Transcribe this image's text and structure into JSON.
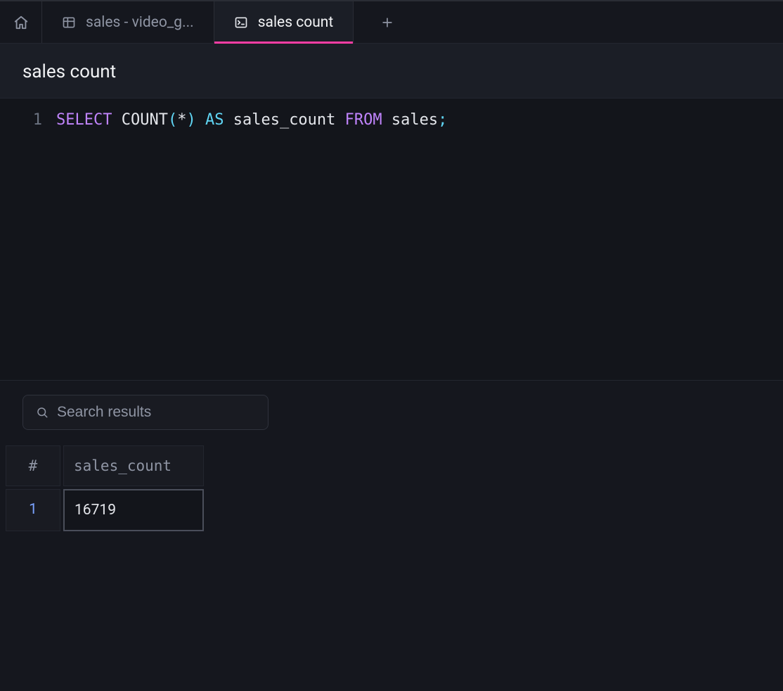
{
  "tabs": {
    "items": [
      {
        "icon": "table",
        "label": "sales - video_g...",
        "active": false
      },
      {
        "icon": "terminal",
        "label": "sales count",
        "active": true
      }
    ]
  },
  "title": "sales count",
  "editor": {
    "lines": [
      {
        "num": "1",
        "tokens": [
          {
            "t": "SELECT",
            "c": "kw"
          },
          {
            "t": " ",
            "c": ""
          },
          {
            "t": "COUNT",
            "c": "fn"
          },
          {
            "t": "(",
            "c": "par"
          },
          {
            "t": "*",
            "c": "ident"
          },
          {
            "t": ")",
            "c": "par"
          },
          {
            "t": " ",
            "c": ""
          },
          {
            "t": "AS",
            "c": "kw2"
          },
          {
            "t": " ",
            "c": ""
          },
          {
            "t": "sales_count",
            "c": "ident"
          },
          {
            "t": " ",
            "c": ""
          },
          {
            "t": "FROM",
            "c": "kw"
          },
          {
            "t": " ",
            "c": ""
          },
          {
            "t": "sales",
            "c": "ident"
          },
          {
            "t": ";",
            "c": "semi"
          }
        ]
      }
    ]
  },
  "results": {
    "search_placeholder": "Search results",
    "header_rownum": "#",
    "columns": [
      "sales_count"
    ],
    "rows": [
      {
        "num": "1",
        "values": [
          "16719"
        ]
      }
    ]
  }
}
